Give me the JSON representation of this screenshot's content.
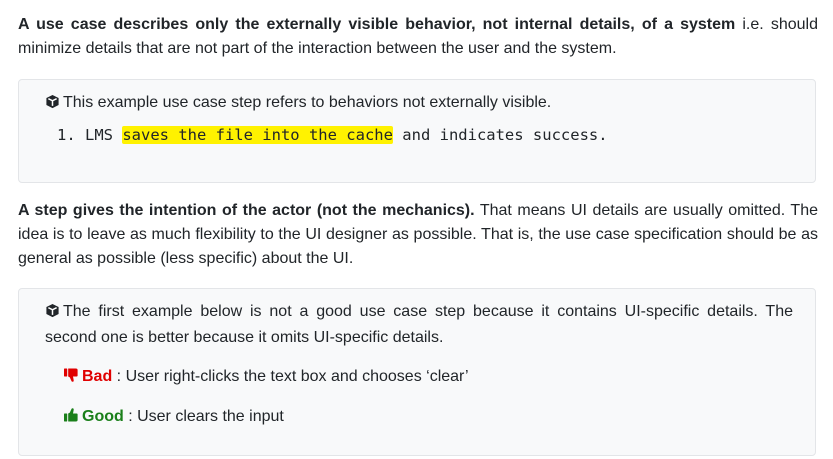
{
  "para1": {
    "bold": "A use case describes only the externally visible behavior, not internal details, of a system",
    "rest": " i.e. should minimize details that are not part of the interaction between the user and the system."
  },
  "box1": {
    "note": "This example use case step refers to behaviors not externally visible.",
    "code": {
      "prefix": "1. LMS ",
      "highlight": "saves the file into the cache",
      "suffix": " and indicates success."
    }
  },
  "para2": {
    "bold": "A step gives the intention of the actor (not the mechanics).",
    "rest": " That means UI details are usually omitted. The idea is to leave as much flexibility to the UI designer as possible. That is, the use case specification should be as general as possible (less specific) about the UI."
  },
  "box2": {
    "note": "The first example below is not a good use case step because it contains UI-specific details. The second one is better because it omits UI-specific details.",
    "bad": {
      "label": "Bad",
      "text": " : User right-clicks the text box and chooses ‘clear’"
    },
    "good": {
      "label": "Good",
      "text": " : User clears the input"
    }
  },
  "colors": {
    "highlight": "#fff200",
    "bad": "#e00000",
    "good": "#1a7f1a",
    "box_background": "#f8f9fa"
  },
  "icons": {
    "note": "cube-icon",
    "bad": "thumbs-down-icon",
    "good": "thumbs-up-icon"
  }
}
